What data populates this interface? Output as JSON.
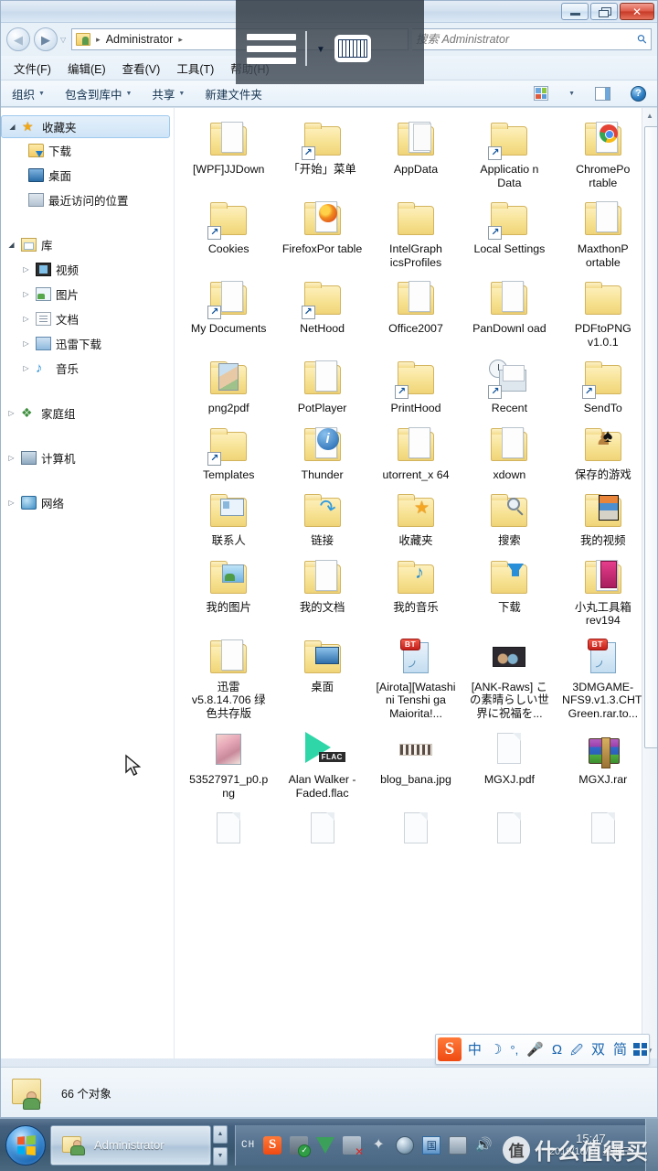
{
  "window": {
    "titlebar": {
      "minimize": "—",
      "restore": "❐",
      "close": "✕"
    },
    "nav": {
      "back": "◀",
      "forward": "▶",
      "history_caret": "▽"
    },
    "address": {
      "crumb_icon": "user-folder-icon",
      "path": "Administrator",
      "sep": "▸"
    },
    "search": {
      "placeholder": "搜索 Administrator",
      "value": "",
      "icon": "search-icon"
    },
    "menubar": [
      "文件(F)",
      "编辑(E)",
      "查看(V)",
      "工具(T)",
      "帮助(H)"
    ],
    "commandbar": {
      "items": [
        "组织",
        "包含到库中",
        "共享",
        "新建文件夹"
      ],
      "dropdown_items": [
        true,
        true,
        true,
        false
      ],
      "right_icons": [
        "view-mode-icon",
        "view-dropdown-caret",
        "preview-pane-icon",
        "help-icon"
      ]
    }
  },
  "overlay": {
    "osk": {
      "menu_icon": "hamburger-lines-icon",
      "caret": "▼",
      "keyboard_icon": "on-screen-keyboard-icon"
    }
  },
  "sidebar": {
    "groups": [
      {
        "name": "收藏夹",
        "icon": "star-icon",
        "arrow": "open",
        "selected": true,
        "indent": 0,
        "children": [
          {
            "name": "下载",
            "icon": "download-folder-icon"
          },
          {
            "name": "桌面",
            "icon": "desktop-icon"
          },
          {
            "name": "最近访问的位置",
            "icon": "recent-places-icon"
          }
        ]
      },
      {
        "name": "库",
        "icon": "library-icon",
        "arrow": "open",
        "selected": false,
        "indent": 0,
        "children": [
          {
            "name": "视频",
            "icon": "video-library-icon",
            "arrow": "closed"
          },
          {
            "name": "图片",
            "icon": "pictures-library-icon",
            "arrow": "closed"
          },
          {
            "name": "文档",
            "icon": "documents-library-icon",
            "arrow": "closed"
          },
          {
            "name": "迅雷下载",
            "icon": "thunder-download-icon",
            "arrow": "closed"
          },
          {
            "name": "音乐",
            "icon": "music-library-icon",
            "arrow": "closed"
          }
        ]
      },
      {
        "name": "家庭组",
        "icon": "homegroup-icon",
        "arrow": "closed",
        "children": []
      },
      {
        "name": "计算机",
        "icon": "computer-icon",
        "arrow": "closed",
        "children": []
      },
      {
        "name": "网络",
        "icon": "network-icon",
        "arrow": "closed",
        "children": []
      }
    ]
  },
  "files": [
    {
      "name": "[WPF]JJDown",
      "icon": "folder-with-doc-icon",
      "shortcut": false
    },
    {
      "name": "「开始」菜单",
      "icon": "folder-icon",
      "shortcut": true
    },
    {
      "name": "AppData",
      "icon": "folder-stack-icon",
      "shortcut": false
    },
    {
      "name": "Applicatio n Data",
      "icon": "folder-icon",
      "shortcut": true
    },
    {
      "name": "ChromePo rtable",
      "icon": "folder-chrome-icon",
      "shortcut": false
    },
    {
      "name": "Cookies",
      "icon": "folder-icon",
      "shortcut": true
    },
    {
      "name": "FirefoxPor table",
      "icon": "folder-firefox-icon",
      "shortcut": false
    },
    {
      "name": "IntelGraph icsProfiles",
      "icon": "folder-icon",
      "shortcut": false
    },
    {
      "name": "Local Settings",
      "icon": "folder-icon",
      "shortcut": true
    },
    {
      "name": "MaxthonP ortable",
      "icon": "folder-with-doc-icon",
      "shortcut": false
    },
    {
      "name": "My Documents",
      "icon": "folder-documents-icon",
      "shortcut": true
    },
    {
      "name": "NetHood",
      "icon": "folder-icon",
      "shortcut": true
    },
    {
      "name": "Office2007",
      "icon": "folder-with-doc-icon",
      "shortcut": false
    },
    {
      "name": "PanDownl oad",
      "icon": "folder-with-doc-icon",
      "shortcut": false
    },
    {
      "name": "PDFtoPNG v1.0.1",
      "icon": "folder-icon",
      "shortcut": false
    },
    {
      "name": "png2pdf",
      "icon": "folder-gallery-icon",
      "shortcut": false
    },
    {
      "name": "PotPlayer",
      "icon": "folder-with-doc-icon",
      "shortcut": false
    },
    {
      "name": "PrintHood",
      "icon": "folder-icon",
      "shortcut": true
    },
    {
      "name": "Recent",
      "icon": "recent-tray-icon",
      "shortcut": true
    },
    {
      "name": "SendTo",
      "icon": "folder-icon",
      "shortcut": true
    },
    {
      "name": "Templates",
      "icon": "folder-icon",
      "shortcut": true
    },
    {
      "name": "Thunder",
      "icon": "folder-info-icon",
      "shortcut": false
    },
    {
      "name": "utorrent_x 64",
      "icon": "folder-with-doc-icon",
      "shortcut": false
    },
    {
      "name": "xdown",
      "icon": "folder-with-doc-icon",
      "shortcut": false
    },
    {
      "name": "保存的游戏",
      "icon": "saved-games-icon",
      "shortcut": false
    },
    {
      "name": "联系人",
      "icon": "contacts-folder-icon",
      "shortcut": false
    },
    {
      "name": "链接",
      "icon": "links-folder-icon",
      "shortcut": false
    },
    {
      "name": "收藏夹",
      "icon": "favorites-folder-icon",
      "shortcut": false
    },
    {
      "name": "搜索",
      "icon": "searches-folder-icon",
      "shortcut": false
    },
    {
      "name": "我的视频",
      "icon": "my-videos-folder-icon",
      "shortcut": false
    },
    {
      "name": "我的图片",
      "icon": "my-pictures-folder-icon",
      "shortcut": false
    },
    {
      "name": "我的文档",
      "icon": "my-documents-folder-icon",
      "shortcut": false
    },
    {
      "name": "我的音乐",
      "icon": "my-music-folder-icon",
      "shortcut": false
    },
    {
      "name": "下载",
      "icon": "downloads-folder-icon",
      "shortcut": false
    },
    {
      "name": "小丸工具箱 rev194",
      "icon": "folder-pink-icon",
      "shortcut": false
    },
    {
      "name": "迅雷 v5.8.14.706 绿色共存版",
      "icon": "folder-with-doc-icon",
      "shortcut": false
    },
    {
      "name": "桌面",
      "icon": "desktop-folder-icon",
      "shortcut": false
    },
    {
      "name": "[Airota][Watashi ni Tenshi ga Maiorita!...",
      "icon": "torrent-file-icon",
      "shortcut": false
    },
    {
      "name": "[ANK-Raws] この素晴らしい世界に祝福を...",
      "icon": "anime-thumb-icon",
      "shortcut": false
    },
    {
      "name": "3DMGAME-NFS9.v1.3.CHT.Green.rar.to...",
      "icon": "torrent-file-icon",
      "shortcut": false
    },
    {
      "name": "53527971_p0.png",
      "icon": "image-thumb-icon",
      "shortcut": false
    },
    {
      "name": "Alan Walker - Faded.flac",
      "icon": "flac-audio-icon",
      "shortcut": false
    },
    {
      "name": "blog_bana.jpg",
      "icon": "banner-thumb-icon",
      "shortcut": false
    },
    {
      "name": "MGXJ.pdf",
      "icon": "generic-document-icon",
      "shortcut": false
    },
    {
      "name": "MGXJ.rar",
      "icon": "winrar-archive-icon",
      "shortcut": false
    },
    {
      "name": "",
      "icon": "generic-document-icon",
      "shortcut": false
    },
    {
      "name": "",
      "icon": "generic-document-icon",
      "shortcut": false
    },
    {
      "name": "",
      "icon": "generic-document-icon",
      "shortcut": false
    },
    {
      "name": "",
      "icon": "generic-document-icon",
      "shortcut": false
    },
    {
      "name": "",
      "icon": "generic-document-icon",
      "shortcut": false
    }
  ],
  "scrollbar": {
    "up": "▲",
    "down": "▼"
  },
  "statusbar": {
    "icon": "user-folder-icon",
    "text": "66 个对象"
  },
  "sogou_bar": {
    "logo": "S",
    "items": [
      "中",
      "☽",
      "°,",
      "mic-icon",
      "Ω",
      "handwriting-icon",
      "双",
      "简",
      "keyboard-grid-icon"
    ]
  },
  "taskbar": {
    "start": "start-orb-icon",
    "task": {
      "label": "Administrator",
      "icon": "explorer-folder-icon"
    },
    "tray": {
      "lang": "CH",
      "icons": [
        "sogou-ime-icon",
        "usb-safe-remove-icon",
        "green-shield-icon",
        "printer-offline-icon",
        "star-icon",
        "globe-icon",
        "blue-app-icon",
        "monitor-icon",
        "speaker-icon"
      ]
    },
    "clock": {
      "time": "15:47",
      "date": "2019/10/16 星期三"
    },
    "show_desktop": "show-desktop-button"
  },
  "watermark": {
    "badge": "值",
    "text": "什么值得买"
  }
}
